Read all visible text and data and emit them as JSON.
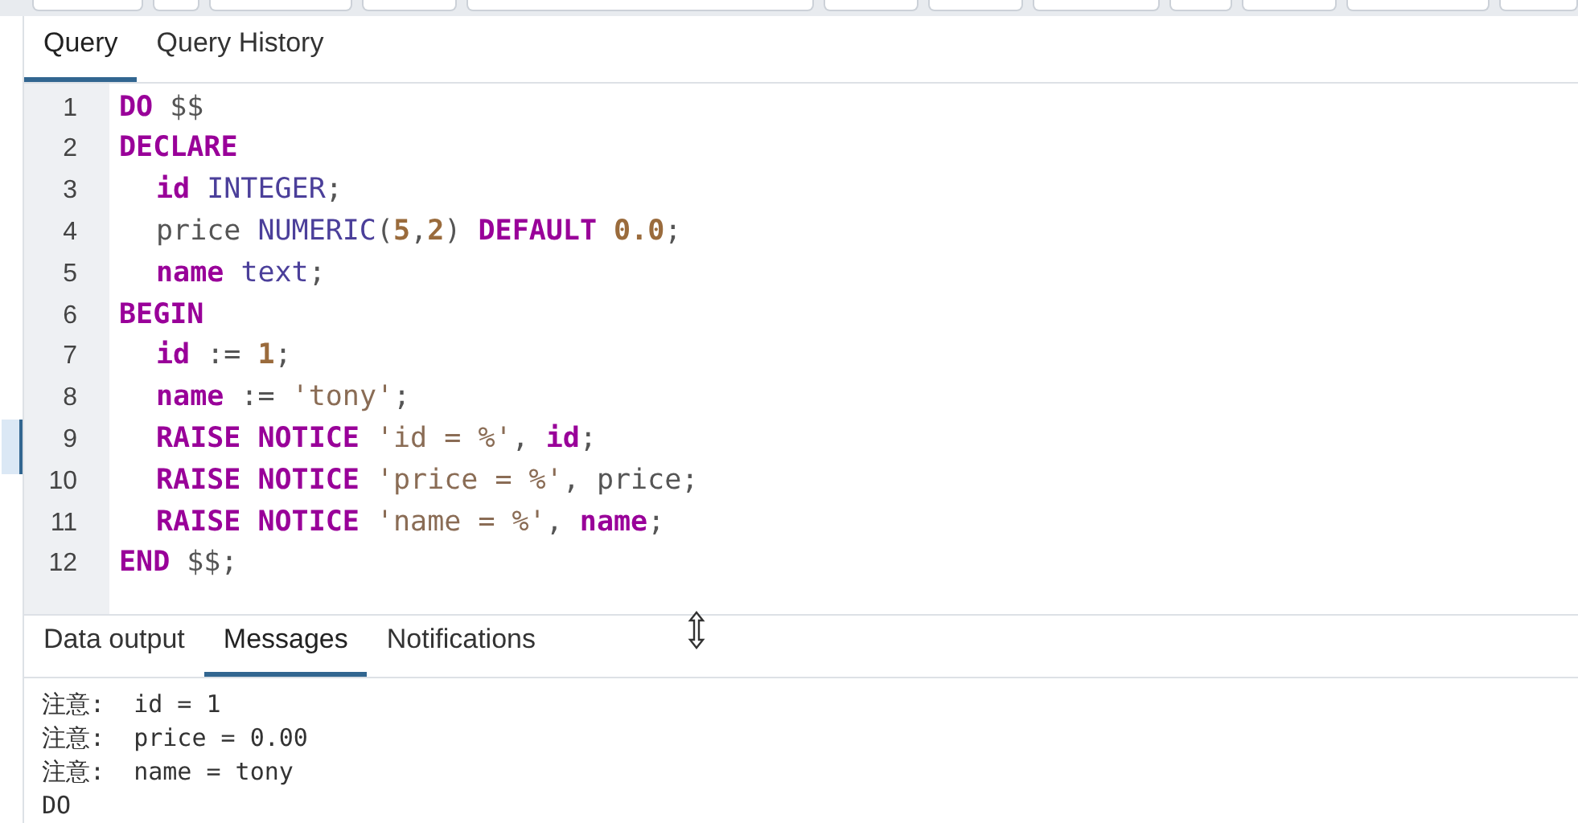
{
  "editor_tabs": [
    {
      "label": "Query",
      "selected": true
    },
    {
      "label": "Query History",
      "selected": false
    }
  ],
  "code_lines": [
    {
      "number": "1",
      "indent": false,
      "current": false,
      "tokens": [
        {
          "t": "DO",
          "kind": "keyword"
        },
        {
          "t": " $$",
          "kind": "plain"
        }
      ]
    },
    {
      "number": "2",
      "indent": false,
      "current": false,
      "tokens": [
        {
          "t": "DECLARE",
          "kind": "keyword"
        }
      ]
    },
    {
      "number": "3",
      "indent": true,
      "current": false,
      "tokens": [
        {
          "t": "id",
          "kind": "keyword"
        },
        {
          "t": " INTEGER",
          "kind": "type"
        },
        {
          "t": ";",
          "kind": "plain"
        }
      ]
    },
    {
      "number": "4",
      "indent": true,
      "current": false,
      "tokens": [
        {
          "t": "price ",
          "kind": "plain"
        },
        {
          "t": "NUMERIC",
          "kind": "type"
        },
        {
          "t": "(",
          "kind": "plain"
        },
        {
          "t": "5",
          "kind": "number"
        },
        {
          "t": ",",
          "kind": "plain"
        },
        {
          "t": "2",
          "kind": "number"
        },
        {
          "t": ") ",
          "kind": "plain"
        },
        {
          "t": "DEFAULT",
          "kind": "keyword"
        },
        {
          "t": " 0.0",
          "kind": "number"
        },
        {
          "t": ";",
          "kind": "plain"
        }
      ]
    },
    {
      "number": "5",
      "indent": true,
      "current": false,
      "tokens": [
        {
          "t": "name",
          "kind": "keyword"
        },
        {
          "t": " text",
          "kind": "type"
        },
        {
          "t": ";",
          "kind": "plain"
        }
      ]
    },
    {
      "number": "6",
      "indent": false,
      "current": false,
      "tokens": [
        {
          "t": "BEGIN",
          "kind": "keyword"
        }
      ]
    },
    {
      "number": "7",
      "indent": true,
      "current": false,
      "tokens": [
        {
          "t": "id",
          "kind": "keyword"
        },
        {
          "t": " := ",
          "kind": "plain"
        },
        {
          "t": "1",
          "kind": "number"
        },
        {
          "t": ";",
          "kind": "plain"
        }
      ]
    },
    {
      "number": "8",
      "indent": true,
      "current": false,
      "tokens": [
        {
          "t": "name",
          "kind": "keyword"
        },
        {
          "t": " := ",
          "kind": "plain"
        },
        {
          "t": "'tony'",
          "kind": "string"
        },
        {
          "t": ";",
          "kind": "plain"
        }
      ]
    },
    {
      "number": "9",
      "indent": true,
      "current": true,
      "tokens": [
        {
          "t": "RAISE NOTICE",
          "kind": "keyword"
        },
        {
          "t": " 'id = %'",
          "kind": "string"
        },
        {
          "t": ", ",
          "kind": "plain"
        },
        {
          "t": "id",
          "kind": "keyword"
        },
        {
          "t": ";",
          "kind": "plain"
        }
      ]
    },
    {
      "number": "10",
      "indent": true,
      "current": false,
      "tokens": [
        {
          "t": "RAISE NOTICE",
          "kind": "keyword"
        },
        {
          "t": " 'price = %'",
          "kind": "string"
        },
        {
          "t": ", price;",
          "kind": "plain"
        }
      ]
    },
    {
      "number": "11",
      "indent": true,
      "current": false,
      "tokens": [
        {
          "t": "RAISE NOTICE",
          "kind": "keyword"
        },
        {
          "t": " 'name = %'",
          "kind": "string"
        },
        {
          "t": ", ",
          "kind": "plain"
        },
        {
          "t": "name",
          "kind": "keyword"
        },
        {
          "t": ";",
          "kind": "plain"
        }
      ]
    },
    {
      "number": "12",
      "indent": false,
      "current": false,
      "tokens": [
        {
          "t": "END",
          "kind": "keyword"
        },
        {
          "t": " $$;",
          "kind": "plain"
        }
      ]
    }
  ],
  "output_tabs": [
    {
      "label": "Data output",
      "selected": false
    },
    {
      "label": "Messages",
      "selected": true
    },
    {
      "label": "Notifications",
      "selected": false
    }
  ],
  "messages": [
    {
      "prefix": "注意:",
      "text": "id = 1"
    },
    {
      "prefix": "注意:",
      "text": "price = 0.00"
    },
    {
      "prefix": "注意:",
      "text": "name = tony"
    },
    {
      "text": "DO"
    }
  ]
}
